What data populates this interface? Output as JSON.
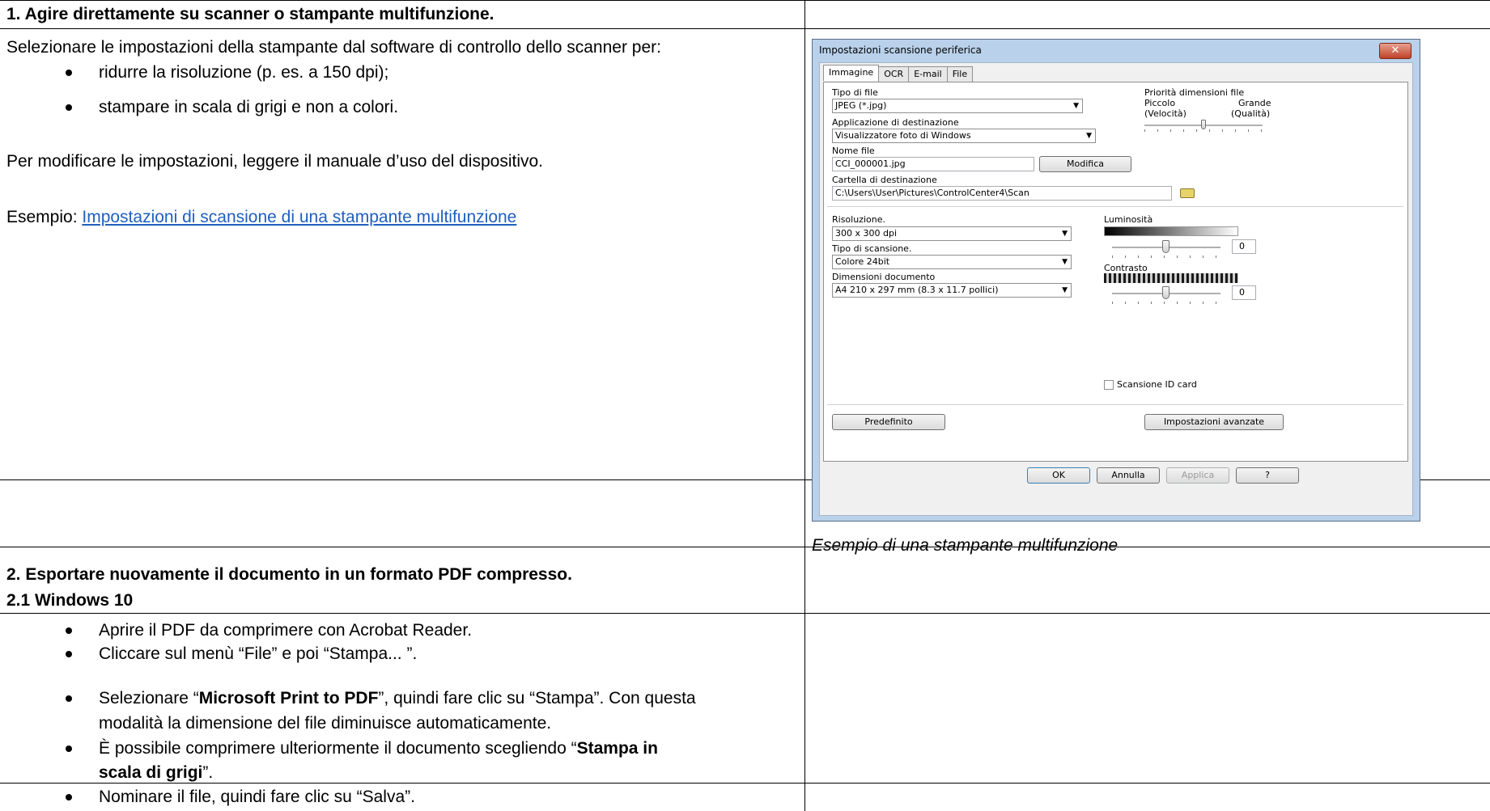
{
  "section1": {
    "heading": "1. Agire direttamente su scanner o stampante multifunzione.",
    "intro": "Selezionare le impostazioni della stampante dal software di controllo dello scanner per:",
    "bullets": [
      "ridurre la risoluzione (p. es. a 150 dpi);",
      "stampare in scala di grigi e non a colori."
    ],
    "manual_note": "Per modificare le impostazioni, leggere il manuale d’uso del dispositivo.",
    "example_prefix": "Esempio: ",
    "example_link": "Impostazioni di scansione di una stampante multifunzione",
    "caption": "Esempio di una stampante multifunzione"
  },
  "dialog": {
    "title": "Impostazioni scansione periferica",
    "close_glyph": "✕",
    "tabs": [
      "Immagine",
      "OCR",
      "E-mail",
      "File"
    ],
    "file_type_label": "Tipo di file",
    "file_type_value": "JPEG (*.jpg)",
    "priority_label": "Priorità dimensioni file",
    "priority_small": "Piccolo",
    "priority_small_sub": "(Velocità)",
    "priority_large": "Grande",
    "priority_large_sub": "(Qualità)",
    "dest_app_label": "Applicazione di destinazione",
    "dest_app_value": "Visualizzatore foto di Windows",
    "file_name_label": "Nome file",
    "file_name_value": "CCI_000001.jpg",
    "modify_button": "Modifica",
    "dest_folder_label": "Cartella di destinazione",
    "dest_folder_value": "C:\\Users\\User\\Pictures\\ControlCenter4\\Scan",
    "resolution_label": "Risoluzione.",
    "resolution_value": "300 x 300 dpi",
    "scan_type_label": "Tipo di scansione.",
    "scan_type_value": "Colore 24bit",
    "doc_size_label": "Dimensioni documento",
    "doc_size_value": "A4 210 x 297 mm (8.3 x 11.7 pollici)",
    "brightness_label": "Luminosità",
    "brightness_value": "0",
    "contrast_label": "Contrasto",
    "contrast_value": "0",
    "id_card_label": "Scansione ID card",
    "default_button": "Predefinito",
    "advanced_button": "Impostazioni avanzate",
    "ok_button": "OK",
    "cancel_button": "Annulla",
    "apply_button": "Applica",
    "help_button": "?"
  },
  "section2": {
    "heading": "2. Esportare nuovamente il documento in un formato PDF compresso.",
    "subheading": "2.1 Windows 10",
    "step1": "Aprire il PDF da comprimere con Acrobat Reader.",
    "step2": "Cliccare sul menù “File” e poi “Stampa... ”.",
    "step3_a": "Selezionare “",
    "step3_b": "Microsoft Print to PDF",
    "step3_c": "”, quindi fare clic su “Stampa”. Con questa",
    "step3_line2": "modalità la dimensione del file diminuisce automaticamente.",
    "step4_a": "È possibile comprimere ulteriormente il documento scegliendo “",
    "step4_b": "Stampa in",
    "step4_line2_b": "scala di grigi",
    "step4_line2_c": "”.",
    "step5": "Nominare il file, quindi fare clic su “Salva”."
  }
}
